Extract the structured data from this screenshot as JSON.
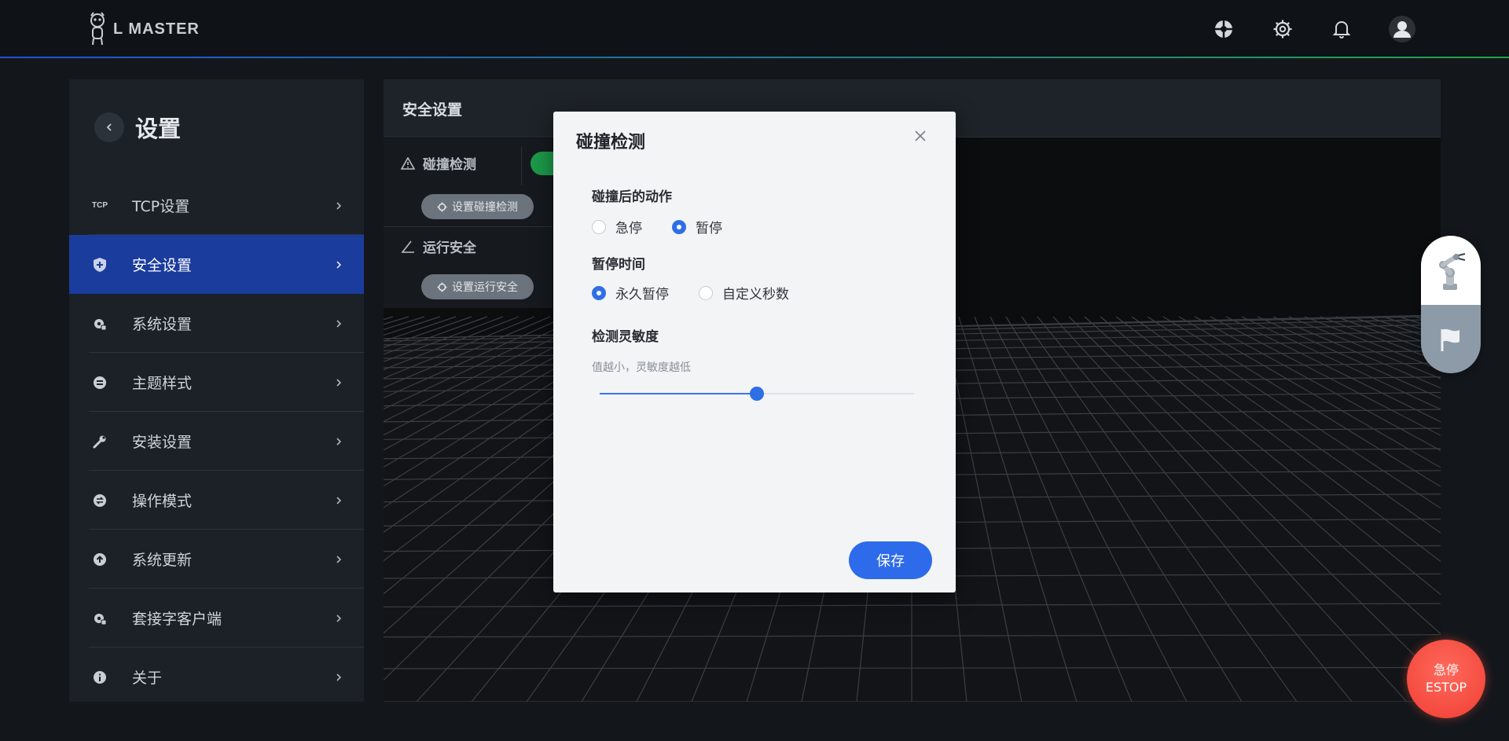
{
  "header": {
    "logo_text": "L MASTER",
    "icons": [
      "target-icon",
      "gear-icon",
      "bell-icon",
      "user-avatar-icon"
    ]
  },
  "sidebar": {
    "title": "设置",
    "items": [
      {
        "label": "TCP设置",
        "icon": "tcp-icon",
        "active": false
      },
      {
        "label": "安全设置",
        "icon": "shield-icon",
        "active": true
      },
      {
        "label": "系统设置",
        "icon": "system-gear-icon",
        "active": false
      },
      {
        "label": "主题样式",
        "icon": "theme-icon",
        "active": false
      },
      {
        "label": "安装设置",
        "icon": "wrench-icon",
        "active": false
      },
      {
        "label": "操作模式",
        "icon": "mode-icon",
        "active": false
      },
      {
        "label": "系统更新",
        "icon": "update-icon",
        "active": false
      },
      {
        "label": "套接字客户端",
        "icon": "socket-icon",
        "active": false
      },
      {
        "label": "关于",
        "icon": "info-icon",
        "active": false
      }
    ],
    "tcp_icon_text": "TCP"
  },
  "main": {
    "title": "安全设置",
    "collision": {
      "label": "碰撞检测",
      "button": "设置碰撞检测"
    },
    "run_safety": {
      "label": "运行安全",
      "button": "设置运行安全"
    }
  },
  "modal": {
    "title": "碰撞检测",
    "action_label": "碰撞后的动作",
    "action_options": [
      {
        "label": "急停",
        "checked": false
      },
      {
        "label": "暂停",
        "checked": true
      }
    ],
    "pause_label": "暂停时间",
    "pause_options": [
      {
        "label": "永久暂停",
        "checked": true
      },
      {
        "label": "自定义秒数",
        "checked": false
      }
    ],
    "sensitivity_label": "检测灵敏度",
    "sensitivity_hint": "值越小，灵敏度越低",
    "sensitivity_fraction": 0.5,
    "save_label": "保存"
  },
  "estop": {
    "line1": "急停",
    "line2": "ESTOP"
  },
  "colors": {
    "accent": "#2d6bea",
    "active_menu": "#1a3c9c",
    "estop": "#f03d33",
    "toggle_green": "#1c9a4a"
  }
}
